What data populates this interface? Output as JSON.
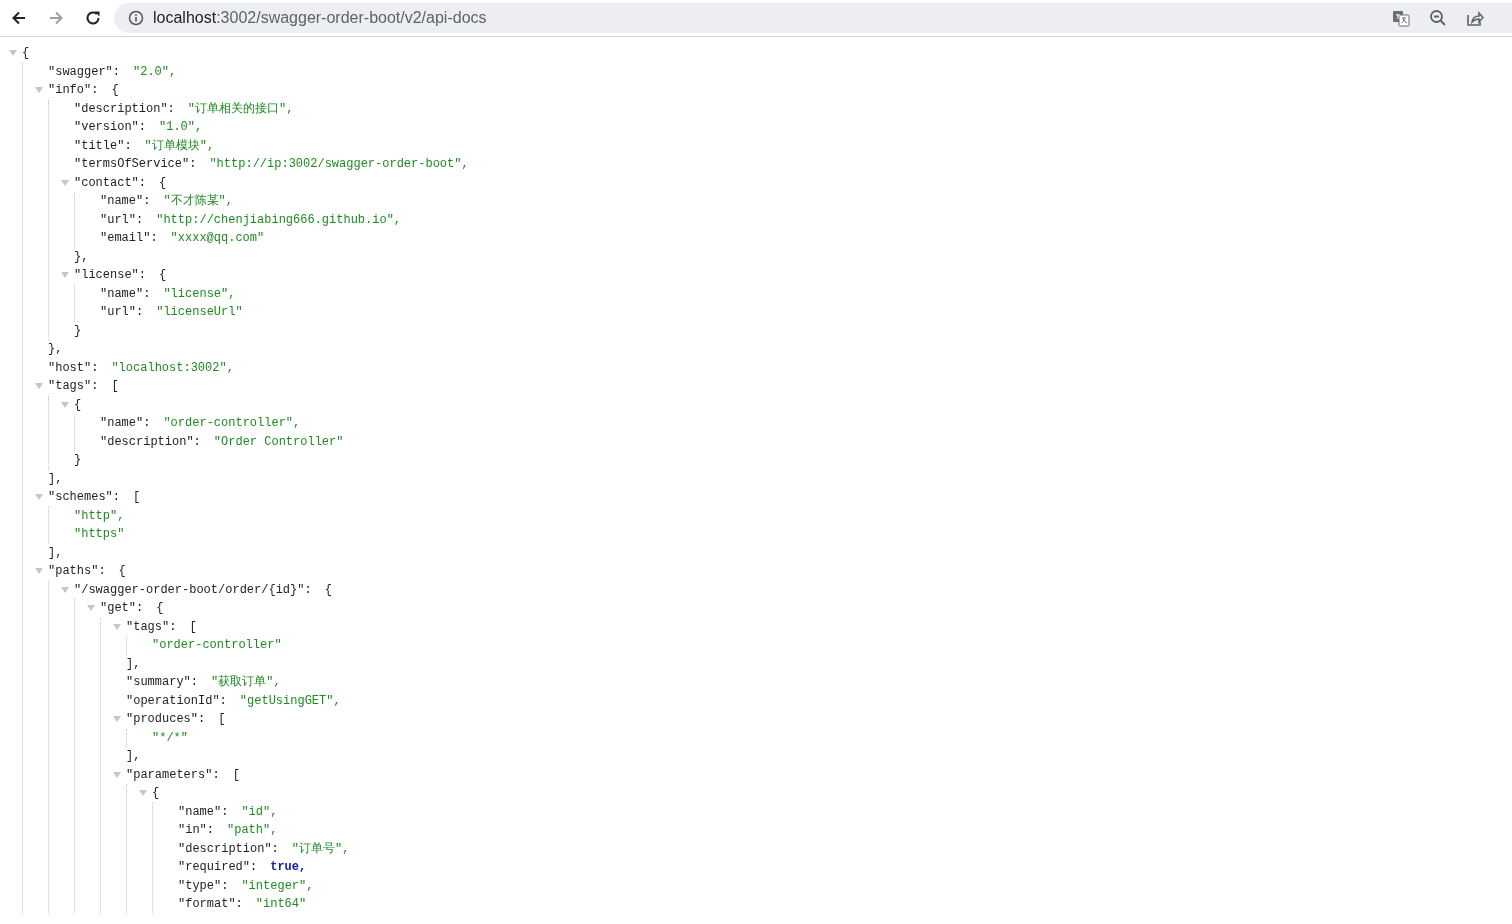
{
  "browser": {
    "nav": [
      {
        "kind": "back",
        "disabled": false
      },
      {
        "kind": "forward",
        "disabled": true
      },
      {
        "kind": "reload",
        "disabled": false
      }
    ],
    "url_host": "localhost",
    "url_rest": ":3002/swagger-order-boot/v2/api-docs",
    "actions": [
      {
        "kind": "translate"
      },
      {
        "kind": "zoom"
      },
      {
        "kind": "share"
      }
    ]
  },
  "json_tree": {
    "open": "{",
    "expanded": true,
    "children": [
      {
        "key": "\"swagger\":",
        "value": "\"2.0\",",
        "kind": "string"
      },
      {
        "key": "\"info\":",
        "open": "{",
        "expanded": true,
        "close": "},",
        "children": [
          {
            "key": "\"description\":",
            "value": "\"订单相关的接口\",",
            "kind": "string"
          },
          {
            "key": "\"version\":",
            "value": "\"1.0\",",
            "kind": "string"
          },
          {
            "key": "\"title\":",
            "value": "\"订单模块\",",
            "kind": "string"
          },
          {
            "key": "\"termsOfService\":",
            "value": "\"http://ip:3002/swagger-order-boot\",",
            "kind": "string"
          },
          {
            "key": "\"contact\":",
            "open": "{",
            "expanded": true,
            "close": "},",
            "children": [
              {
                "key": "\"name\":",
                "value": "\"不才陈某\",",
                "kind": "string"
              },
              {
                "key": "\"url\":",
                "value": "\"http://chenjiabing666.github.io\",",
                "kind": "string"
              },
              {
                "key": "\"email\":",
                "value": "\"xxxx@qq.com\"",
                "kind": "string"
              }
            ]
          },
          {
            "key": "\"license\":",
            "open": "{",
            "expanded": true,
            "close": "}",
            "children": [
              {
                "key": "\"name\":",
                "value": "\"license\",",
                "kind": "string"
              },
              {
                "key": "\"url\":",
                "value": "\"licenseUrl\"",
                "kind": "string"
              }
            ]
          }
        ]
      },
      {
        "key": "\"host\":",
        "value": "\"localhost:3002\",",
        "kind": "string"
      },
      {
        "key": "\"tags\":",
        "open": "[",
        "expanded": true,
        "close": "],",
        "children": [
          {
            "open": "{",
            "expanded": true,
            "close": "}",
            "children": [
              {
                "key": "\"name\":",
                "value": "\"order-controller\",",
                "kind": "string"
              },
              {
                "key": "\"description\":",
                "value": "\"Order Controller\"",
                "kind": "string"
              }
            ]
          }
        ]
      },
      {
        "key": "\"schemes\":",
        "open": "[",
        "expanded": true,
        "close": "],",
        "children": [
          {
            "value": "\"http\",",
            "kind": "string"
          },
          {
            "value": "\"https\"",
            "kind": "string"
          }
        ]
      },
      {
        "key": "\"paths\":",
        "open": "{",
        "expanded": true,
        "children": [
          {
            "key": "\"/swagger-order-boot/order/{id}\":",
            "open": "{",
            "expanded": true,
            "children": [
              {
                "key": "\"get\":",
                "open": "{",
                "expanded": true,
                "children": [
                  {
                    "key": "\"tags\":",
                    "open": "[",
                    "expanded": true,
                    "close": "],",
                    "children": [
                      {
                        "value": "\"order-controller\"",
                        "kind": "string"
                      }
                    ]
                  },
                  {
                    "key": "\"summary\":",
                    "value": "\"获取订单\",",
                    "kind": "string"
                  },
                  {
                    "key": "\"operationId\":",
                    "value": "\"getUsingGET\",",
                    "kind": "string"
                  },
                  {
                    "key": "\"produces\":",
                    "open": "[",
                    "expanded": true,
                    "close": "],",
                    "children": [
                      {
                        "value": "\"*/*\"",
                        "kind": "string"
                      }
                    ]
                  },
                  {
                    "key": "\"parameters\":",
                    "open": "[",
                    "expanded": true,
                    "children": [
                      {
                        "open": "{",
                        "expanded": true,
                        "children": [
                          {
                            "key": "\"name\":",
                            "value": "\"id\",",
                            "kind": "string"
                          },
                          {
                            "key": "\"in\":",
                            "value": "\"path\",",
                            "kind": "string"
                          },
                          {
                            "key": "\"description\":",
                            "value": "\"订单号\",",
                            "kind": "string"
                          },
                          {
                            "key": "\"required\":",
                            "value": "true,",
                            "kind": "literal"
                          },
                          {
                            "key": "\"type\":",
                            "value": "\"integer\",",
                            "kind": "string"
                          },
                          {
                            "key": "\"format\":",
                            "value": "\"int64\"",
                            "kind": "string"
                          }
                        ]
                      }
                    ]
                  }
                ]
              }
            ]
          }
        ]
      }
    ]
  }
}
